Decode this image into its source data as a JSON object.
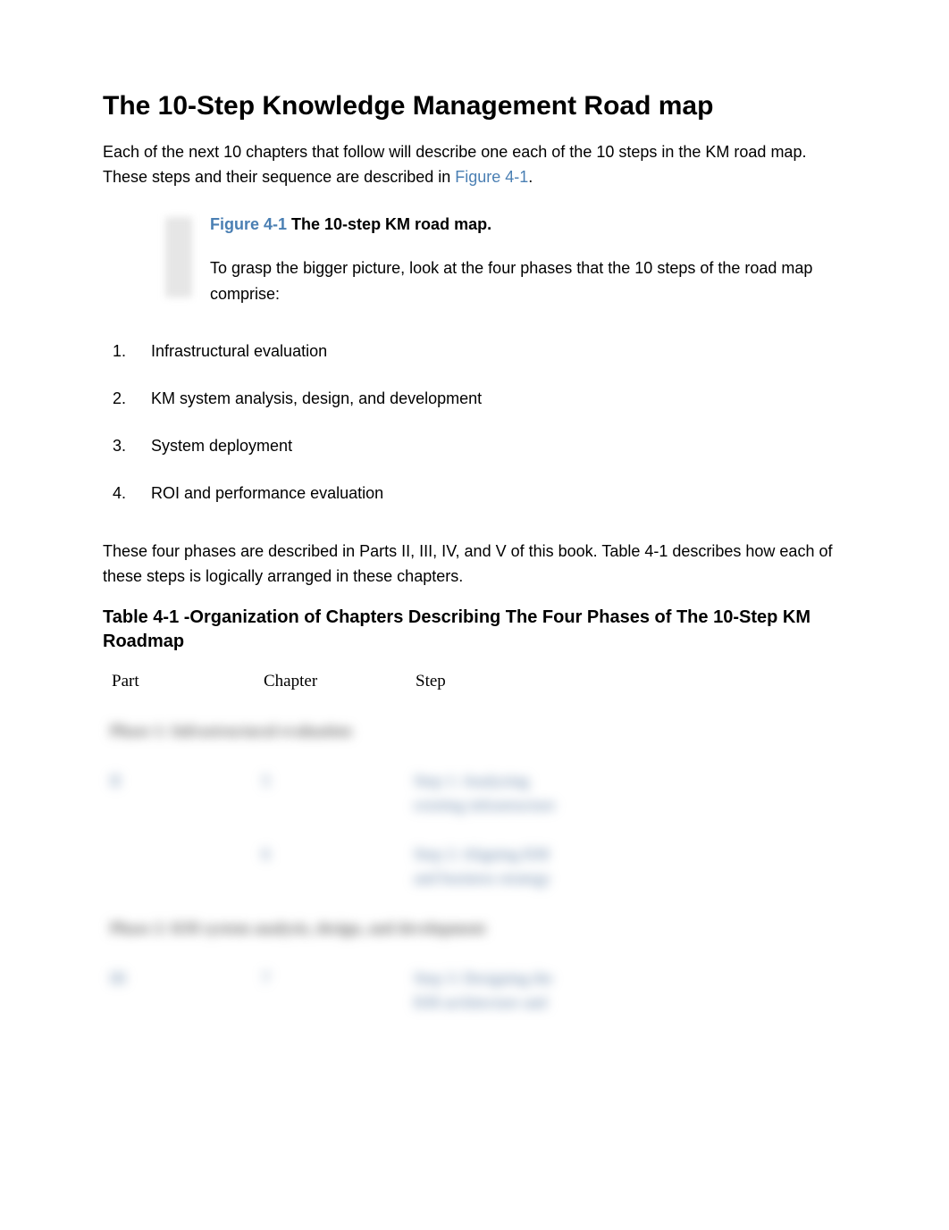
{
  "heading": "The 10-Step Knowledge Management Road map",
  "intro_before_link": "Each of the next 10 chapters that follow will describe one each of the 10 steps in the KM road map. These steps and their sequence are described in ",
  "intro_link_text": "Figure 4-1",
  "intro_after_link": ".",
  "figure": {
    "link_text": "Figure 4-1",
    "caption_rest": " The 10-step KM road map.",
    "body": "To grasp the bigger picture, look at the four phases that the 10 steps of the road map comprise:"
  },
  "phases": [
    {
      "num": "1.",
      "text": "Infrastructural evaluation"
    },
    {
      "num": "2.",
      "text": "KM system analysis, design, and development"
    },
    {
      "num": "3.",
      "text": "System deployment"
    },
    {
      "num": "4.",
      "text": "ROI and performance evaluation"
    }
  ],
  "mid_paragraph": "These four phases are described in Parts II, III, IV, and V of this book. Table 4-1 describes how each of these steps is logically arranged in these chapters.",
  "table_title": "Table 4-1 -Organization of Chapters Describing The Four Phases of The 10-Step KM Roadmap",
  "table": {
    "headers": {
      "part": "Part",
      "chapter": "Chapter",
      "step": "Step"
    },
    "rows": [
      {
        "type": "phase",
        "label": "Phase 1: Infrastructural evaluation"
      },
      {
        "type": "data",
        "part": "II",
        "chapter": "5",
        "step": "Step 1: Analyzing existing infrastructure"
      },
      {
        "type": "data",
        "part": "",
        "chapter": "6",
        "step": "Step 2: Aligning KM and business strategy"
      },
      {
        "type": "phase",
        "label": "Phase 2: KM system analysis, design, and development"
      },
      {
        "type": "data",
        "part": "III",
        "chapter": "7",
        "step": "Step 3: Designing the KM architecture and"
      }
    ]
  }
}
